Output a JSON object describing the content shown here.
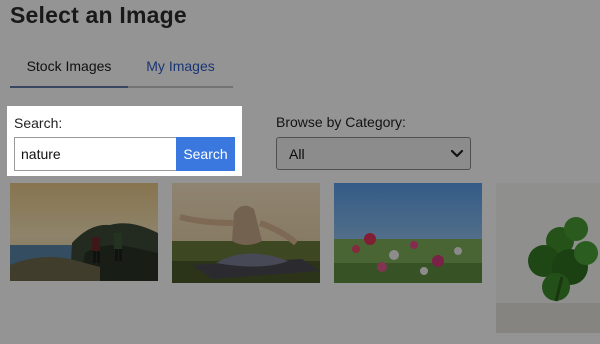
{
  "page": {
    "title": "Select an Image"
  },
  "tabs": [
    {
      "label": "Stock Images",
      "active": true
    },
    {
      "label": "My Images",
      "active": false
    }
  ],
  "search": {
    "label": "Search:",
    "value": "nature",
    "button_label": "Search"
  },
  "category": {
    "label": "Browse by Category:",
    "selected": "All"
  },
  "images": [
    {
      "subject": "hikers-on-coastal-cliff"
    },
    {
      "subject": "woman-meditating-yoga"
    },
    {
      "subject": "wildflower-meadow"
    },
    {
      "subject": "clover-leaves"
    }
  ],
  "colors": {
    "accent": "#3a78e0",
    "tab_link": "#2d5cc9",
    "overlay": "rgba(0,0,0,0.42)"
  }
}
